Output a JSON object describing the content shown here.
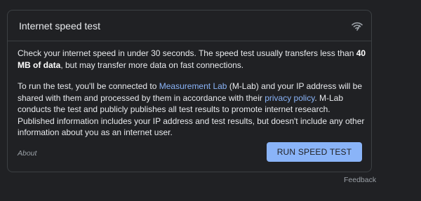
{
  "card": {
    "title": "Internet speed test",
    "icon": "wifi-speed-icon"
  },
  "intro": {
    "text_before": "Check your internet speed in under 30 seconds. The speed test usually transfers less than ",
    "bold": "40 MB of data",
    "text_after": ", but may transfer more data on fast connections."
  },
  "details": {
    "text_1": "To run the test, you'll be connected to ",
    "link_mlab": "Measurement Lab",
    "text_2": " (M-Lab) and your IP address will be shared with them and processed by them in accordance with their ",
    "link_privacy": "privacy policy",
    "text_3": ". M-Lab conducts the test and publicly publishes all test results to promote internet research. Published information includes your IP address and test results, but doesn't include any other information about you as an internet user."
  },
  "footer": {
    "about": "About",
    "run_button": "RUN SPEED TEST",
    "feedback": "Feedback"
  },
  "colors": {
    "background": "#202124",
    "text": "#e8eaed",
    "link": "#8ab4f8",
    "button": "#8ab4f8",
    "muted": "#9aa0a6"
  }
}
